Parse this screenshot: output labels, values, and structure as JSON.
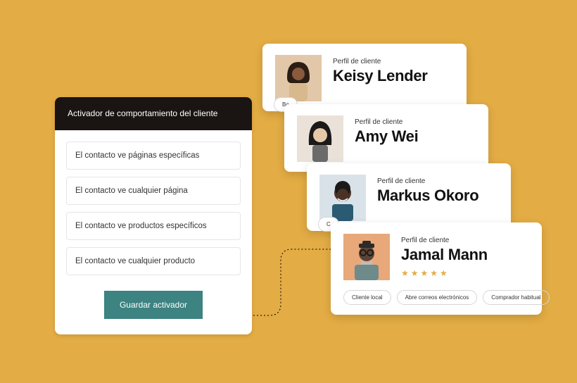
{
  "trigger": {
    "header": "Activador de comportamiento del cliente",
    "options": [
      "El contacto ve páginas específicas",
      "El contacto ve cualquier página",
      "El contacto ve productos específicos",
      "El contacto ve cualquier producto"
    ],
    "save_label": "Guardar activador"
  },
  "profile_label": "Perfil de cliente",
  "profiles": [
    {
      "name": "Keisy Lender",
      "partial_tag": "Bo"
    },
    {
      "name": "Amy Wei"
    },
    {
      "name": "Markus Okoro",
      "partial_tag": "C"
    },
    {
      "name": "Jamal Mann",
      "stars": 5,
      "tags": [
        "Cliente local",
        "Abre correos electrónicos",
        "Comprador habitual"
      ]
    }
  ],
  "colors": {
    "background": "#e3ac44",
    "teal": "#3c8381",
    "header_dark": "#1a1513"
  }
}
